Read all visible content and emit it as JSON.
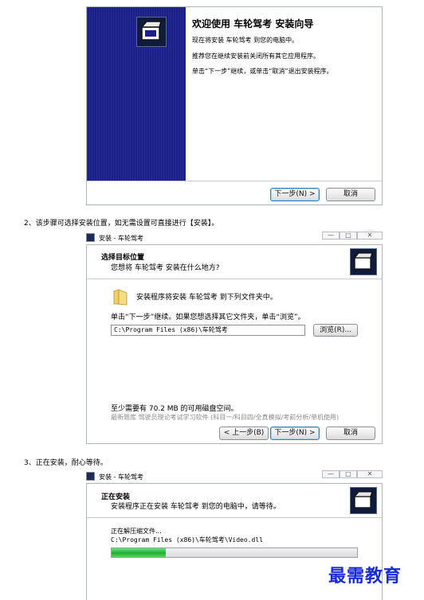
{
  "win1": {
    "title": "欢迎使用 车轮驾考 安装向导",
    "line1": "现在将安装 车轮驾考 到您的电脑中。",
    "line2": "推荐您在继续安装前关闭所有其它应用程序。",
    "line3": "单击“下一步”继续，或单击“取消”退出安装程序。",
    "next": "下一步(N) >",
    "cancel": "取消"
  },
  "step2": {
    "text": "2、该步骤可选择安装位置，如无需设置可直接进行【安装】。"
  },
  "win2": {
    "window_title": "安装 - 车轮驾考",
    "heading": "选择目标位置",
    "subheading": "您想将 车轮驾考 安装在什么地方?",
    "info": "安装程序将安装 车轮驾考 到下列文件夹中。",
    "hint": "单击“下一步”继续。如果您想选择其它文件夹，单击“浏览”。",
    "path": "C:\\Program Files (x86)\\车轮驾考",
    "browse": "浏览(R)...",
    "space": "至少需要有 70.2 MB 的可用磁盘空间。",
    "promo": "最新题库 驾驶员理论考试学习软件 (科目一/科目四/全真模拟/考前分析/单机使用)",
    "back": "< 上一步(B)",
    "next": "下一步(N) >",
    "cancel": "取消"
  },
  "step3": {
    "text": "3、正在安装，耐心等待。"
  },
  "win3": {
    "window_title": "安装 - 车轮驾考",
    "heading": "正在安装",
    "subheading": "安装程序正在安装 车轮驾考 到您的电脑中，请等待。",
    "status": "正在解压缩文件...",
    "file": "C:\\Program Files (x86)\\车轮驾考\\Video.dll",
    "progress": 0.22
  },
  "watermark": "最需教育",
  "colors": {
    "banner": "#1b1f8a",
    "progress": "#27b83a",
    "watermark": "#1a2ad6"
  }
}
